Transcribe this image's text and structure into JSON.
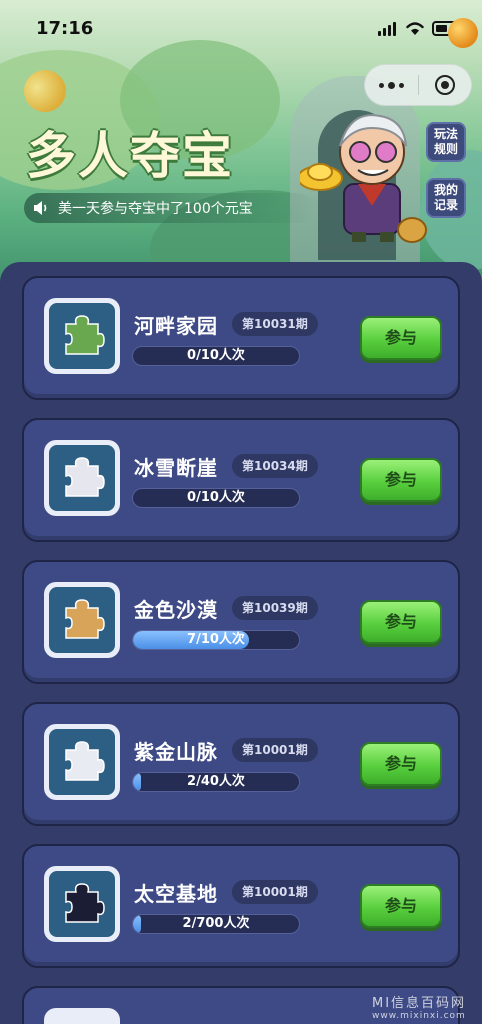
{
  "status_bar": {
    "time": "17:16"
  },
  "header": {
    "title": "多人夺宝",
    "notice": "美一天参与夺宝中了100个元宝",
    "side_buttons": [
      {
        "label": "玩法\n规则"
      },
      {
        "label": "我的\n记录"
      }
    ]
  },
  "items": [
    {
      "name": "河畔家园",
      "period": "第10031期",
      "progress_text": "0/10人次",
      "progress": 0.0,
      "button": "参与"
    },
    {
      "name": "冰雪断崖",
      "period": "第10034期",
      "progress_text": "0/10人次",
      "progress": 0.0,
      "button": "参与"
    },
    {
      "name": "金色沙漠",
      "period": "第10039期",
      "progress_text": "7/10人次",
      "progress": 0.7,
      "button": "参与"
    },
    {
      "name": "紫金山脉",
      "period": "第10001期",
      "progress_text": "2/40人次",
      "progress": 0.05,
      "button": "参与"
    },
    {
      "name": "太空基地",
      "period": "第10001期",
      "progress_text": "2/700人次",
      "progress": 0.003,
      "button": "参与"
    }
  ],
  "watermark": {
    "line1": "MI信息百码网",
    "line2": "www.mixinxi.com"
  },
  "icons": {
    "speaker": "speaker-icon",
    "puzzle": "puzzle-piece-icon"
  },
  "colors": {
    "join_button": "#58cf3e",
    "card_bg": "#3e4a85",
    "progress_fill": "#4b8fe6"
  }
}
